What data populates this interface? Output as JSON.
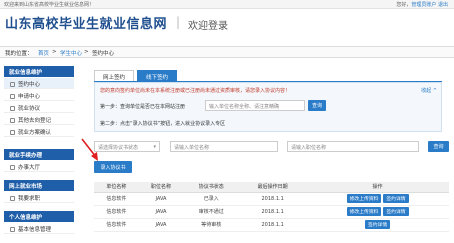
{
  "topbar": {
    "welcome": "欢迎来到山东省高校毕业生就业信息网！",
    "greeting": "您好，",
    "user_link": "管理员账户",
    "logout": "退出"
  },
  "header": {
    "logo": "山东高校毕业生就业信息网",
    "separator": "|",
    "subtitle": "欢迎登录"
  },
  "breadcrumb": {
    "prefix": "我的位置：",
    "home": "首页",
    "sep1": ">",
    "level2": "学生中心",
    "sep2": ">",
    "current": "签约中心"
  },
  "sidebar": {
    "sections": [
      {
        "title": "就业信息维护",
        "items": [
          "签约中心",
          "申请中心",
          "就业协议",
          "其他去向登记",
          "就业方案确认"
        ]
      },
      {
        "title": "就业手续办理",
        "items": [
          "办事大厅"
        ]
      },
      {
        "title": "网上就业市场",
        "items": [
          "我要求职"
        ]
      },
      {
        "title": "个人信息维护",
        "items": [
          "基本信息管理"
        ]
      }
    ]
  },
  "tabs": {
    "tab1": "网上签约",
    "tab2": "线下签约"
  },
  "notice": {
    "text": "您的意向签约单位尚未在本系统注册或已注册尚未通过资质审核，请您录入协议内容！",
    "collapse": "收起 ^",
    "step1": "第一步：查询单位是否已在本网站注册",
    "step1_placeholder": "输入单位名称全称、请注意精确",
    "step1_button": "查询",
    "step2": "第二步：点击“录入协议书”按钮，进入就业协议录入专区"
  },
  "filter": {
    "status_placeholder": "请选择协议书状态",
    "status_arrow": "▾",
    "unit_placeholder": "请输入单位名称",
    "position_placeholder": "请输入职位名称",
    "search_button": "查询"
  },
  "enter_button": "录入协议书",
  "table": {
    "headers": [
      "单位名称",
      "职位名称",
      "协议书状态",
      "最后操作日期",
      "操作"
    ],
    "rows": [
      {
        "unit": "信息软件",
        "position": "JAVA",
        "status": "已录入",
        "date": "2018.1.1",
        "actions": [
          "修改上传资料",
          "签约详情"
        ]
      },
      {
        "unit": "信息软件",
        "position": "JAVA",
        "status": "审核不通过",
        "date": "2018.1.1",
        "actions": [
          "修改上传资料",
          "签约详情"
        ]
      },
      {
        "unit": "信息软件",
        "position": "JAVA",
        "status": "等待审核",
        "date": "2018.1.1",
        "actions": [
          "签约详情"
        ]
      }
    ]
  },
  "colors": {
    "brand": "#1f5ea8",
    "accent": "#2a7bc8",
    "annotation_arrow": "#e02020"
  }
}
